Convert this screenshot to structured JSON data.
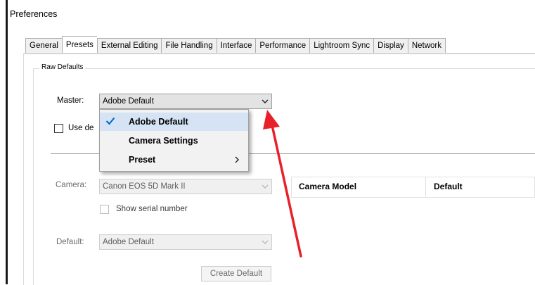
{
  "window": {
    "title": "Preferences"
  },
  "tabs": [
    {
      "label": "General"
    },
    {
      "label": "Presets",
      "active": true
    },
    {
      "label": "External Editing"
    },
    {
      "label": "File Handling"
    },
    {
      "label": "Interface"
    },
    {
      "label": "Performance"
    },
    {
      "label": "Lightroom Sync"
    },
    {
      "label": "Display"
    },
    {
      "label": "Network"
    }
  ],
  "raw_defaults": {
    "group_label": "Raw Defaults",
    "master_label": "Master:",
    "master_value": "Adobe Default",
    "use_defaults_label": "Use de",
    "camera_label": "Camera:",
    "camera_value": "Canon EOS 5D Mark II",
    "show_serial_label": "Show serial number",
    "default_label": "Default:",
    "default_value": "Adobe Default",
    "create_default_label": "Create Default"
  },
  "dropdown_menu": {
    "items": [
      {
        "label": "Adobe Default",
        "checked": true
      },
      {
        "label": "Camera Settings"
      },
      {
        "label": "Preset",
        "submenu": true
      }
    ]
  },
  "table": {
    "headers": [
      "Camera Model",
      "Default"
    ]
  },
  "colors": {
    "annotation_arrow": "#e8202a",
    "menu_hover": "#d5e3f5",
    "check": "#0067c0"
  },
  "icons": {
    "dropdown": "chevron-down-icon",
    "check": "checkmark-icon",
    "submenu": "chevron-right-icon"
  }
}
